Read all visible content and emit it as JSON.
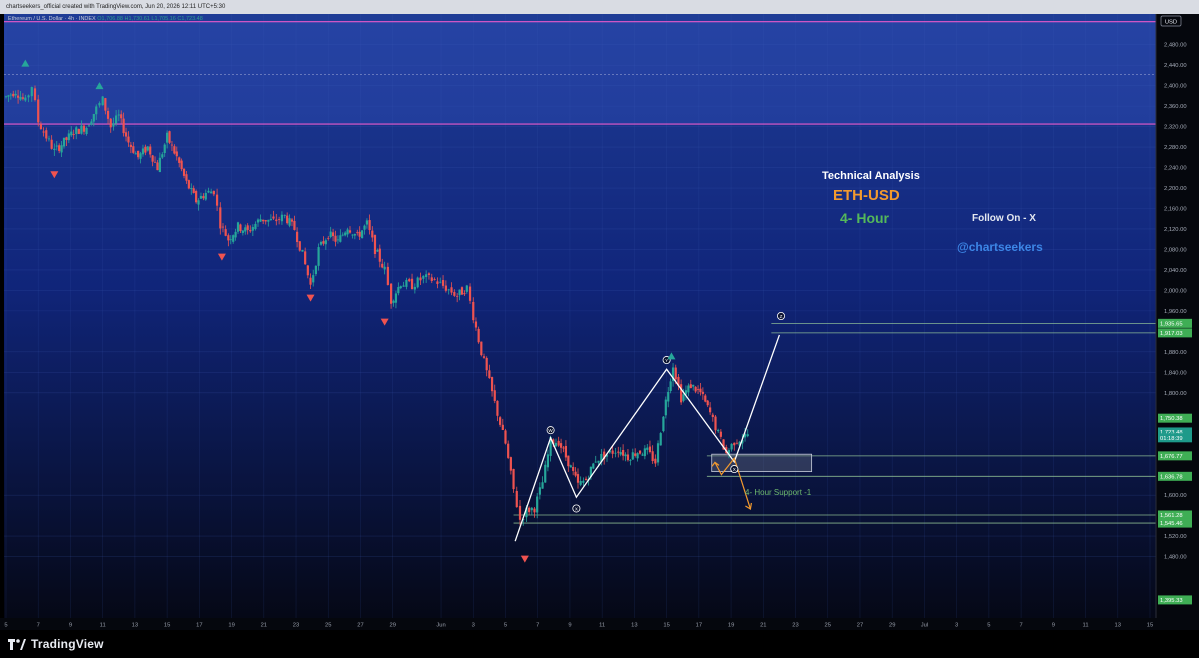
{
  "watermark_top": "chartseekers_official created with TradingView.com, Jun 20, 2026 12:11 UTC+5:30",
  "header": {
    "symbol": "Ethereum / U.S. Dollar · 4h · INDEX",
    "ohlc": "O1,706.88 H1,730.61 L1,705.16 C1,723.48"
  },
  "currency_button": "USD",
  "brand": "TradingView",
  "annotations": {
    "technical": "Technical Analysis",
    "pair": "ETH-USD",
    "timeframe": "4- Hour",
    "follow": "Follow On - X",
    "handle": "@chartseekers",
    "support": "4- Hour Support -1"
  },
  "colors": {
    "bg_top": "#1f3c96",
    "bg_bottom": "#050816",
    "up": "#26a69a",
    "down": "#ef5350",
    "resistance": "#e85acb",
    "support_line": "#9dd29d",
    "wave": "#ffffff",
    "projection": "#f39a2e",
    "price_tag_green": "#3fae55",
    "price_tag_teal": "#1e9a8a"
  },
  "chart_data": {
    "type": "line",
    "title": "Ethereum / U.S. Dollar · 4h · INDEX",
    "ylim": [
      1360,
      2540
    ],
    "y_ticks": [
      "2,480.00",
      "2,440.00",
      "2,400.00",
      "2,360.00",
      "2,320.00",
      "2,280.00",
      "2,240.00",
      "2,200.00",
      "2,160.00",
      "2,120.00",
      "2,080.00",
      "2,040.00",
      "2,000.00",
      "1,960.00",
      "1,880.00",
      "1,840.00",
      "1,800.00",
      "1,600.00",
      "1,520.00",
      "1,480.00"
    ],
    "x_ticks": [
      {
        "label": "5",
        "day": 5
      },
      {
        "label": "7",
        "day": 7
      },
      {
        "label": "9",
        "day": 9
      },
      {
        "label": "11",
        "day": 11
      },
      {
        "label": "13",
        "day": 13
      },
      {
        "label": "15",
        "day": 15
      },
      {
        "label": "17",
        "day": 17
      },
      {
        "label": "19",
        "day": 19
      },
      {
        "label": "21",
        "day": 21
      },
      {
        "label": "23",
        "day": 23
      },
      {
        "label": "25",
        "day": 25
      },
      {
        "label": "27",
        "day": 27
      },
      {
        "label": "29",
        "day": 29
      },
      {
        "label": "Jun",
        "day": 32
      },
      {
        "label": "3",
        "day": 34
      },
      {
        "label": "5",
        "day": 36
      },
      {
        "label": "7",
        "day": 38
      },
      {
        "label": "9",
        "day": 40
      },
      {
        "label": "11",
        "day": 42
      },
      {
        "label": "13",
        "day": 44
      },
      {
        "label": "15",
        "day": 46
      },
      {
        "label": "17",
        "day": 48
      },
      {
        "label": "19",
        "day": 50
      },
      {
        "label": "21",
        "day": 52
      },
      {
        "label": "23",
        "day": 54
      },
      {
        "label": "25",
        "day": 56
      },
      {
        "label": "27",
        "day": 58
      },
      {
        "label": "29",
        "day": 60
      },
      {
        "label": "Jul",
        "day": 62
      },
      {
        "label": "3",
        "day": 64
      },
      {
        "label": "5",
        "day": 66
      },
      {
        "label": "7",
        "day": 68
      },
      {
        "label": "9",
        "day": 70
      },
      {
        "label": "11",
        "day": 72
      },
      {
        "label": "13",
        "day": 74
      },
      {
        "label": "15",
        "day": 76
      }
    ],
    "price_tags": [
      {
        "label": "1,935.65",
        "value": 1935.65,
        "color": "#3fae55"
      },
      {
        "label": "1,917.03",
        "value": 1917.03,
        "color": "#3fae55"
      },
      {
        "label": "1,750.38",
        "value": 1750.38,
        "color": "#3fae55"
      },
      {
        "label": "1,723.48",
        "value": 1723.48,
        "color": "#1e9a8a"
      },
      {
        "label": "01:18:39",
        "value": 1712,
        "color": "#1e9a8a"
      },
      {
        "label": "1,676.77",
        "value": 1676.77,
        "color": "#3fae55"
      },
      {
        "label": "1,636.78",
        "value": 1636.78,
        "color": "#3fae55"
      },
      {
        "label": "1,561.28",
        "value": 1561.28,
        "color": "#3fae55"
      },
      {
        "label": "1,545.46",
        "value": 1545.46,
        "color": "#3fae55"
      },
      {
        "label": "1,395.33",
        "value": 1395.33,
        "color": "#3fae55"
      }
    ],
    "resistance_zone": [
      2325,
      2525
    ],
    "levels": [
      1935.65,
      1917.03,
      1676.77,
      1636.78,
      1561.28,
      1545.46
    ],
    "dotted_level": 2422,
    "price_path": [
      {
        "day": 5.0,
        "p": 2378
      },
      {
        "day": 5.6,
        "p": 2390
      },
      {
        "day": 6.2,
        "p": 2368
      },
      {
        "day": 6.6,
        "p": 2400
      },
      {
        "day": 7.0,
        "p": 2330
      },
      {
        "day": 7.5,
        "p": 2300
      },
      {
        "day": 8.0,
        "p": 2272
      },
      {
        "day": 8.6,
        "p": 2290
      },
      {
        "day": 9.2,
        "p": 2310
      },
      {
        "day": 10.0,
        "p": 2320
      },
      {
        "day": 10.6,
        "p": 2355
      },
      {
        "day": 11.0,
        "p": 2372
      },
      {
        "day": 11.5,
        "p": 2320
      },
      {
        "day": 12.0,
        "p": 2340
      },
      {
        "day": 12.6,
        "p": 2290
      },
      {
        "day": 13.2,
        "p": 2260
      },
      {
        "day": 13.8,
        "p": 2280
      },
      {
        "day": 14.4,
        "p": 2240
      },
      {
        "day": 15.0,
        "p": 2300
      },
      {
        "day": 15.6,
        "p": 2260
      },
      {
        "day": 16.2,
        "p": 2210
      },
      {
        "day": 16.8,
        "p": 2175
      },
      {
        "day": 17.4,
        "p": 2190
      },
      {
        "day": 17.9,
        "p": 2195
      },
      {
        "day": 18.3,
        "p": 2130
      },
      {
        "day": 18.8,
        "p": 2100
      },
      {
        "day": 19.4,
        "p": 2125
      },
      {
        "day": 20.0,
        "p": 2115
      },
      {
        "day": 20.8,
        "p": 2140
      },
      {
        "day": 21.6,
        "p": 2135
      },
      {
        "day": 22.3,
        "p": 2145
      },
      {
        "day": 22.9,
        "p": 2120
      },
      {
        "day": 23.4,
        "p": 2070
      },
      {
        "day": 23.9,
        "p": 2010
      },
      {
        "day": 24.4,
        "p": 2080
      },
      {
        "day": 25.0,
        "p": 2110
      },
      {
        "day": 25.6,
        "p": 2095
      },
      {
        "day": 26.2,
        "p": 2125
      },
      {
        "day": 26.8,
        "p": 2105
      },
      {
        "day": 27.4,
        "p": 2130
      },
      {
        "day": 27.9,
        "p": 2080
      },
      {
        "day": 28.5,
        "p": 2040
      },
      {
        "day": 28.9,
        "p": 1980
      },
      {
        "day": 29.5,
        "p": 2015
      },
      {
        "day": 30.2,
        "p": 2010
      },
      {
        "day": 30.9,
        "p": 2025
      },
      {
        "day": 31.6,
        "p": 2020
      },
      {
        "day": 32.3,
        "p": 2005
      },
      {
        "day": 33.0,
        "p": 1990
      },
      {
        "day": 33.6,
        "p": 2005
      },
      {
        "day": 34.0,
        "p": 1950
      },
      {
        "day": 34.5,
        "p": 1880
      },
      {
        "day": 35.0,
        "p": 1820
      },
      {
        "day": 35.5,
        "p": 1760
      },
      {
        "day": 36.0,
        "p": 1700
      },
      {
        "day": 36.5,
        "p": 1610
      },
      {
        "day": 36.9,
        "p": 1552
      },
      {
        "day": 37.3,
        "p": 1570
      },
      {
        "day": 37.8,
        "p": 1575
      },
      {
        "day": 38.3,
        "p": 1625
      },
      {
        "day": 38.8,
        "p": 1705
      },
      {
        "day": 39.3,
        "p": 1705
      },
      {
        "day": 39.9,
        "p": 1665
      },
      {
        "day": 40.5,
        "p": 1620
      },
      {
        "day": 41.0,
        "p": 1630
      },
      {
        "day": 41.6,
        "p": 1670
      },
      {
        "day": 42.3,
        "p": 1680
      },
      {
        "day": 43.0,
        "p": 1690
      },
      {
        "day": 43.6,
        "p": 1675
      },
      {
        "day": 44.2,
        "p": 1685
      },
      {
        "day": 44.8,
        "p": 1685
      },
      {
        "day": 45.3,
        "p": 1665
      },
      {
        "day": 45.8,
        "p": 1760
      },
      {
        "day": 46.4,
        "p": 1855
      },
      {
        "day": 46.9,
        "p": 1790
      },
      {
        "day": 47.5,
        "p": 1815
      },
      {
        "day": 48.1,
        "p": 1800
      },
      {
        "day": 48.7,
        "p": 1760
      },
      {
        "day": 49.2,
        "p": 1720
      },
      {
        "day": 49.7,
        "p": 1682
      },
      {
        "day": 50.2,
        "p": 1705
      },
      {
        "day": 50.7,
        "p": 1712
      },
      {
        "day": 51.2,
        "p": 1723
      }
    ],
    "wave_path": [
      {
        "day": 36.6,
        "p": 1510
      },
      {
        "day": 38.8,
        "p": 1712
      },
      {
        "day": 40.4,
        "p": 1596
      },
      {
        "day": 46.0,
        "p": 1846
      },
      {
        "day": 50.2,
        "p": 1665
      },
      {
        "day": 53.0,
        "p": 1913
      }
    ],
    "wave_labels": [
      {
        "label": "W",
        "day": 38.8,
        "p": 1727
      },
      {
        "label": "X",
        "day": 40.4,
        "p": 1574
      },
      {
        "label": "Y",
        "day": 46.0,
        "p": 1864
      },
      {
        "label": "X",
        "day": 50.2,
        "p": 1651
      },
      {
        "label": "Z",
        "day": 53.1,
        "p": 1950
      }
    ],
    "markers": [
      {
        "type": "up",
        "day": 6.2,
        "p": 2444
      },
      {
        "type": "up",
        "day": 10.8,
        "p": 2400
      },
      {
        "type": "down",
        "day": 8.0,
        "p": 2226
      },
      {
        "type": "down",
        "day": 18.4,
        "p": 2065
      },
      {
        "type": "down",
        "day": 28.5,
        "p": 1938
      },
      {
        "type": "down",
        "day": 37.2,
        "p": 1475
      },
      {
        "type": "down",
        "day": 23.9,
        "p": 1985
      },
      {
        "type": "up",
        "day": 46.3,
        "p": 1872
      }
    ],
    "support_box": {
      "day_from": 48.8,
      "day_to": 55.0,
      "p_from": 1646,
      "p_to": 1680
    },
    "projection_path": [
      {
        "day": 49.0,
        "p": 1664
      },
      {
        "day": 49.4,
        "p": 1640
      },
      {
        "day": 50.2,
        "p": 1672
      },
      {
        "day": 51.2,
        "p": 1573
      }
    ],
    "x_range": [
      5,
      76
    ]
  }
}
